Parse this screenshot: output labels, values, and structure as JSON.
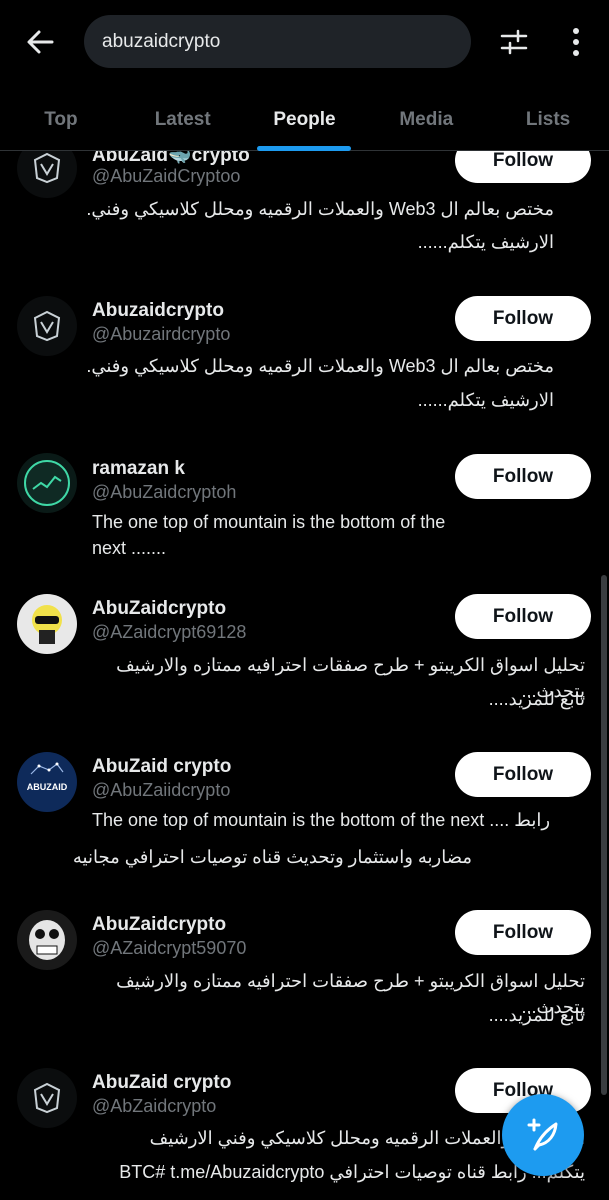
{
  "header": {
    "search_value": "abuzaidcrypto"
  },
  "tabs": [
    {
      "label": "Top"
    },
    {
      "label": "Latest"
    },
    {
      "label": "People",
      "active": true
    },
    {
      "label": "Media"
    },
    {
      "label": "Lists"
    }
  ],
  "colors": {
    "accent": "#1d9bf0",
    "background": "#000000",
    "muted_text": "#71767b"
  },
  "results": [
    {
      "name": "AbuZaid🐳crypto",
      "handle": "@AbuZaidCryptoo",
      "bio_line1": "مختص بعالم ال Web3 والعملات الرقميه ومحلل كلاسيكي وفني.",
      "bio_line2": "الارشيف يتكلم......",
      "follow_label": "Follow",
      "avatar_icon": "dark-logo-avatar"
    },
    {
      "name": "Abuzaidcrypto",
      "handle": "@Abuzairdcrypto",
      "bio_line1": "مختص بعالم ال Web3 والعملات الرقميه ومحلل كلاسيكي وفني.",
      "bio_line2": "الارشيف يتكلم......",
      "follow_label": "Follow",
      "avatar_icon": "dark-logo-avatar"
    },
    {
      "name": "ramazan k",
      "handle": "@AbuZaidcryptoh",
      "bio_line1": " The one top of  mountain is the bottom of the",
      "bio_line2": "next .......",
      "follow_label": "Follow",
      "avatar_icon": "chart-logo-avatar"
    },
    {
      "name": "AbuZaidcrypto",
      "handle": "@AZaidcrypt69128",
      "bio_line1": "تحليل اسواق الكريبتو + طرح صفقات احترافيه ممتازه والارشيف يتحدث...",
      "bio_line2": "تابع للمزيد....",
      "follow_label": "Follow",
      "avatar_icon": "cartoon-avatar"
    },
    {
      "name": "AbuZaid crypto",
      "handle": "@AbuZaiidcrypto",
      "bio_line1": "The one top of mountain is the bottom of the next .... رابط",
      "bio_line2": "مضاربه واستثمار وتحديث قناه توصيات احترافي مجانيه",
      "follow_label": "Follow",
      "avatar_icon": "abuzaid-logo-avatar",
      "avatar_text": "ABUZAID"
    },
    {
      "name": "AbuZaidcrypto",
      "handle": "@AZaidcrypt59070",
      "bio_line1": "تحليل اسواق الكريبتو + طرح صفقات احترافيه ممتازه والارشيف يتحدث...",
      "bio_line2": "تابع للمزيد....",
      "follow_label": "Follow",
      "avatar_icon": "robot-avatar"
    },
    {
      "name": "AbuZaid crypto",
      "handle": "@AbZaidcrypto",
      "bio_line1": "ال Web3 والعملات الرقميه ومحلل كلاسيكي وفني الارشيف",
      "bio_line2": "يتكلم... رابط قناه توصيات احترافي BTC# t.me/Abuzaidcrypto",
      "follow_label": "Follow",
      "avatar_icon": "dark-logo-avatar"
    }
  ]
}
